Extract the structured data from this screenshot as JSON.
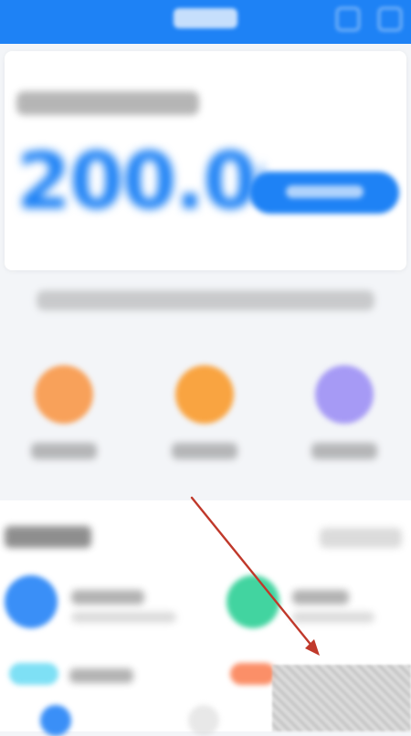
{
  "balance": {
    "amount": "200.00"
  },
  "colors": {
    "brand": "#1e82f5",
    "orange": "#f8a15a",
    "yellow_orange": "#f9a441",
    "purple": "#a69af5",
    "blue": "#3a8ff7",
    "green": "#42d4a0",
    "cyan": "#7ee0f5",
    "salmon": "#fb8f68",
    "annotation_arrow": "#c0392b"
  },
  "header": {
    "action_icon": "scan-icon"
  },
  "card": {
    "action_icon": "wallet-button-icon"
  },
  "shortcuts": [
    {
      "icon": "orange-circle-icon"
    },
    {
      "icon": "yellow-circle-icon"
    },
    {
      "icon": "purple-circle-icon"
    }
  ],
  "services": [
    {
      "icon": "blue-service-icon"
    },
    {
      "icon": "green-service-icon"
    },
    {
      "icon": "cyan-service-icon"
    },
    {
      "icon": "salmon-service-icon"
    }
  ]
}
